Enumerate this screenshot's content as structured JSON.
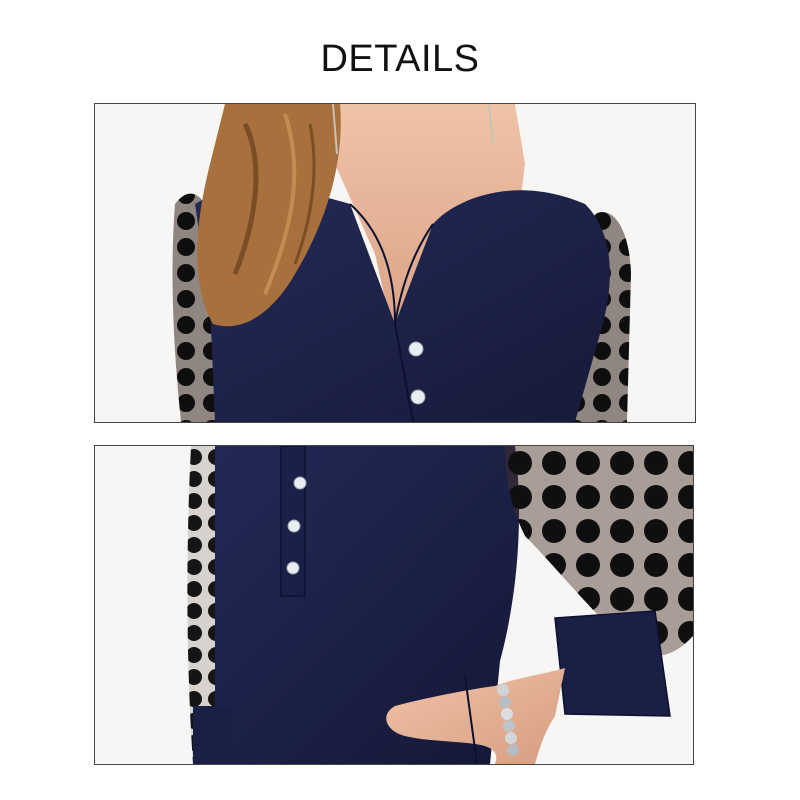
{
  "header": {
    "title": "DETAILS"
  },
  "colors": {
    "background": "#ffffff",
    "blouse_navy": "#1c2147",
    "mesh_black": "#141414",
    "skin": "#e8b79a",
    "hair": "#a8703c",
    "button_white": "#e9eef2"
  },
  "panels": [
    {
      "id": "neckline-detail",
      "subject": "model-neckline-closeup"
    },
    {
      "id": "sleeve-detail",
      "subject": "model-sleeve-and-hip-closeup"
    }
  ]
}
